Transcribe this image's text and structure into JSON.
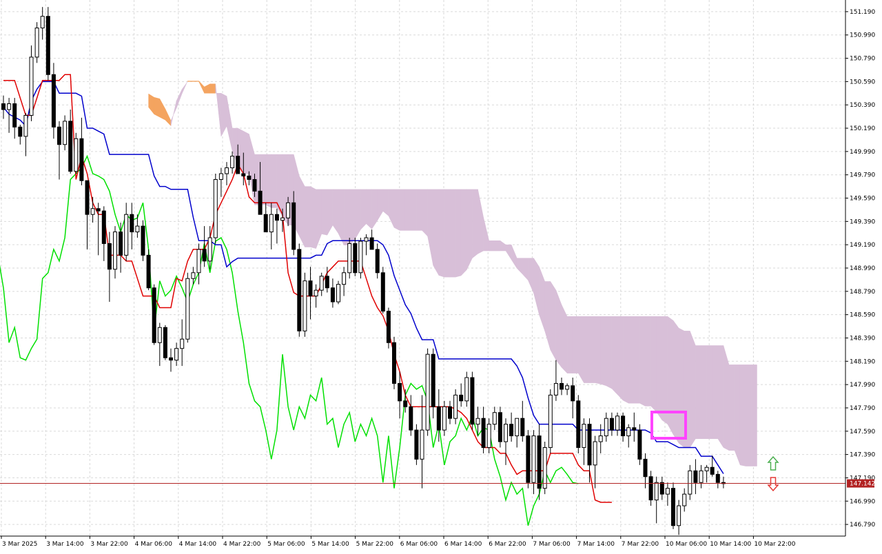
{
  "chart_data": {
    "type": "candlestick",
    "indicator": "Ichimoku Kinko Hyo",
    "ylim": [
      146.69,
      151.29
    ],
    "y_ticks": [
      "151.190",
      "150.990",
      "150.790",
      "150.590",
      "150.390",
      "150.190",
      "149.990",
      "149.790",
      "149.590",
      "149.390",
      "149.190",
      "148.990",
      "148.790",
      "148.590",
      "148.390",
      "148.190",
      "147.990",
      "147.790",
      "147.590",
      "147.390",
      "147.190",
      "146.990",
      "146.790"
    ],
    "x_ticks": [
      "3 Mar 2025",
      "3 Mar 14:00",
      "3 Mar 22:00",
      "4 Mar 06:00",
      "4 Mar 14:00",
      "4 Mar 22:00",
      "5 Mar 06:00",
      "5 Mar 14:00",
      "5 Mar 22:00",
      "6 Mar 06:00",
      "6 Mar 14:00",
      "6 Mar 22:00",
      "7 Mar 06:00",
      "7 Mar 14:00",
      "7 Mar 22:00",
      "10 Mar 06:00",
      "10 Mar 14:00",
      "10 Mar 22:00"
    ],
    "current_price": "147.142",
    "grid": true,
    "colors": {
      "background": "#ffffff",
      "grid": "#d9d9d9",
      "tenkan_sen": "#e00000",
      "kijun_sen": "#0000cc",
      "chikou_span": "#00e000",
      "cloud_bullish": "#f4a460",
      "cloud_bearish": "#d8bfd8",
      "candle_bull_body": "#ffffff",
      "candle_bear_body": "#000000",
      "price_line": "#b22222",
      "highlight_box": "#ff44ff",
      "arrow_up": "#4caf50",
      "arrow_down": "#e53935"
    },
    "candles": [
      [
        150.4,
        150.47,
        150.27,
        150.35
      ],
      [
        150.35,
        150.45,
        150.15,
        150.4
      ],
      [
        150.4,
        150.45,
        150.1,
        150.2
      ],
      [
        150.2,
        150.22,
        150.05,
        150.12
      ],
      [
        150.12,
        150.32,
        149.95,
        150.3
      ],
      [
        150.3,
        150.9,
        150.25,
        150.8
      ],
      [
        150.8,
        151.1,
        150.75,
        151.05
      ],
      [
        151.05,
        151.23,
        150.95,
        151.15
      ],
      [
        151.15,
        151.23,
        150.6,
        150.65
      ],
      [
        150.65,
        150.75,
        150.1,
        150.2
      ],
      [
        150.2,
        150.25,
        149.75,
        150.05
      ],
      [
        150.05,
        150.3,
        150.0,
        150.25
      ],
      [
        150.25,
        150.35,
        149.8,
        149.82
      ],
      [
        149.82,
        150.15,
        149.8,
        150.1
      ],
      [
        150.1,
        150.28,
        149.7,
        149.74
      ],
      [
        149.74,
        149.74,
        149.15,
        149.45
      ],
      [
        149.45,
        149.6,
        149.38,
        149.5
      ],
      [
        149.5,
        149.55,
        149.1,
        149.48
      ],
      [
        149.48,
        149.52,
        149.05,
        149.2
      ],
      [
        149.2,
        149.3,
        148.7,
        148.98
      ],
      [
        148.98,
        149.35,
        148.9,
        149.3
      ],
      [
        149.3,
        149.38,
        148.95,
        149.1
      ],
      [
        149.1,
        149.55,
        149.05,
        149.45
      ],
      [
        149.45,
        149.55,
        149.15,
        149.3
      ],
      [
        149.3,
        149.45,
        149.25,
        149.35
      ],
      [
        149.35,
        149.4,
        149.05,
        149.1
      ],
      [
        149.1,
        149.15,
        148.8,
        148.82
      ],
      [
        148.82,
        148.85,
        148.33,
        148.35
      ],
      [
        148.35,
        148.52,
        148.15,
        148.48
      ],
      [
        148.48,
        148.5,
        148.2,
        148.22
      ],
      [
        148.22,
        148.3,
        148.1,
        148.2
      ],
      [
        148.2,
        148.35,
        148.15,
        148.3
      ],
      [
        148.3,
        148.55,
        148.15,
        148.38
      ],
      [
        148.38,
        148.95,
        148.35,
        148.9
      ],
      [
        148.9,
        149.0,
        148.85,
        148.95
      ],
      [
        148.95,
        149.2,
        148.85,
        149.15
      ],
      [
        149.15,
        149.35,
        149.0,
        149.05
      ],
      [
        149.05,
        149.35,
        148.98,
        149.25
      ],
      [
        149.25,
        149.8,
        149.2,
        149.75
      ],
      [
        149.75,
        149.85,
        149.6,
        149.8
      ],
      [
        149.8,
        149.9,
        149.7,
        149.85
      ],
      [
        149.85,
        149.99,
        149.8,
        149.95
      ],
      [
        149.95,
        150.05,
        149.9,
        149.8
      ],
      [
        149.8,
        149.98,
        149.7,
        149.78
      ],
      [
        149.78,
        149.82,
        149.7,
        149.75
      ],
      [
        149.75,
        149.8,
        149.6,
        149.65
      ],
      [
        149.65,
        149.9,
        149.55,
        149.45
      ],
      [
        149.45,
        149.55,
        149.3,
        149.3
      ],
      [
        149.3,
        149.55,
        149.15,
        149.45
      ],
      [
        149.45,
        149.5,
        149.2,
        149.4
      ],
      [
        149.4,
        149.5,
        149.3,
        149.42
      ],
      [
        149.42,
        149.6,
        149.35,
        149.55
      ],
      [
        149.55,
        149.65,
        149.1,
        149.15
      ],
      [
        149.15,
        149.2,
        148.4,
        148.45
      ],
      [
        148.45,
        148.95,
        148.4,
        148.88
      ],
      [
        148.88,
        149.0,
        148.55,
        148.75
      ],
      [
        148.75,
        148.85,
        148.65,
        148.8
      ],
      [
        148.8,
        148.95,
        148.75,
        148.92
      ],
      [
        148.92,
        149.0,
        148.78,
        148.82
      ],
      [
        148.82,
        148.9,
        148.65,
        148.7
      ],
      [
        148.7,
        148.88,
        148.68,
        148.85
      ],
      [
        148.85,
        149.0,
        148.75,
        148.95
      ],
      [
        148.95,
        149.25,
        148.9,
        149.2
      ],
      [
        149.2,
        149.25,
        148.92,
        148.95
      ],
      [
        148.95,
        149.25,
        148.9,
        149.22
      ],
      [
        149.22,
        149.28,
        149.1,
        149.25
      ],
      [
        149.25,
        149.32,
        149.15,
        149.15
      ],
      [
        149.15,
        149.2,
        148.9,
        148.95
      ],
      [
        148.95,
        149.0,
        148.6,
        148.62
      ],
      [
        148.62,
        148.65,
        148.3,
        148.35
      ],
      [
        148.35,
        148.4,
        147.95,
        148.0
      ],
      [
        148.0,
        148.1,
        147.7,
        147.85
      ],
      [
        147.85,
        147.95,
        147.75,
        147.8
      ],
      [
        147.8,
        147.9,
        147.55,
        147.6
      ],
      [
        147.6,
        147.65,
        147.3,
        147.35
      ],
      [
        147.35,
        147.9,
        147.1,
        147.6
      ],
      [
        147.6,
        148.3,
        147.55,
        148.25
      ],
      [
        148.25,
        148.3,
        147.7,
        147.8
      ],
      [
        147.8,
        147.95,
        147.5,
        147.6
      ],
      [
        147.6,
        147.85,
        147.55,
        147.8
      ],
      [
        147.8,
        147.85,
        147.65,
        147.7
      ],
      [
        147.7,
        147.95,
        147.65,
        147.9
      ],
      [
        147.9,
        148.0,
        147.8,
        147.85
      ],
      [
        147.85,
        148.1,
        147.8,
        148.05
      ],
      [
        148.05,
        148.1,
        147.6,
        147.65
      ],
      [
        147.65,
        147.8,
        147.55,
        147.7
      ],
      [
        147.7,
        147.8,
        147.4,
        147.45
      ],
      [
        147.45,
        147.7,
        147.4,
        147.65
      ],
      [
        147.65,
        147.8,
        147.6,
        147.75
      ],
      [
        147.75,
        147.8,
        147.45,
        147.5
      ],
      [
        147.5,
        147.7,
        147.3,
        147.65
      ],
      [
        147.65,
        147.75,
        147.5,
        147.55
      ],
      [
        147.55,
        147.7,
        147.45,
        147.7
      ],
      [
        147.7,
        147.85,
        147.5,
        147.55
      ],
      [
        147.55,
        147.6,
        147.1,
        147.15
      ],
      [
        147.15,
        147.6,
        147.05,
        147.55
      ],
      [
        147.55,
        147.65,
        147.0,
        147.1
      ],
      [
        147.1,
        147.5,
        147.05,
        147.45
      ],
      [
        147.45,
        147.95,
        147.4,
        147.9
      ],
      [
        147.9,
        148.2,
        147.85,
        148.0
      ],
      [
        148.0,
        148.05,
        147.9,
        147.95
      ],
      [
        147.95,
        148.0,
        147.9,
        147.98
      ],
      [
        147.98,
        148.05,
        147.7,
        147.85
      ],
      [
        147.85,
        147.9,
        147.4,
        147.45
      ],
      [
        147.45,
        147.7,
        147.3,
        147.65
      ],
      [
        147.65,
        147.7,
        147.15,
        147.3
      ],
      [
        147.3,
        147.55,
        147.1,
        147.5
      ],
      [
        147.5,
        147.65,
        147.4,
        147.55
      ],
      [
        147.55,
        147.75,
        147.5,
        147.7
      ],
      [
        147.7,
        147.75,
        147.55,
        147.6
      ],
      [
        147.6,
        147.75,
        147.55,
        147.72
      ],
      [
        147.72,
        147.75,
        147.5,
        147.55
      ],
      [
        147.55,
        147.65,
        147.45,
        147.62
      ],
      [
        147.62,
        147.75,
        147.5,
        147.6
      ],
      [
        147.6,
        147.65,
        147.3,
        147.35
      ],
      [
        147.35,
        147.4,
        147.1,
        147.2
      ],
      [
        147.2,
        147.25,
        146.95,
        147.0
      ],
      [
        147.0,
        147.2,
        146.8,
        147.15
      ],
      [
        147.15,
        147.2,
        147.0,
        147.05
      ],
      [
        147.05,
        147.15,
        146.95,
        147.1
      ],
      [
        147.1,
        147.15,
        146.75,
        146.78
      ],
      [
        146.78,
        147.0,
        146.7,
        146.95
      ],
      [
        146.95,
        147.1,
        146.9,
        147.05
      ],
      [
        147.05,
        147.3,
        147.0,
        147.25
      ],
      [
        147.25,
        147.35,
        147.05,
        147.15
      ],
      [
        147.15,
        147.3,
        147.1,
        147.25
      ],
      [
        147.25,
        147.3,
        147.15,
        147.28
      ],
      [
        147.28,
        147.38,
        147.2,
        147.22
      ],
      [
        147.22,
        147.25,
        147.1,
        147.15
      ],
      [
        147.15,
        147.2,
        147.1,
        147.14
      ]
    ],
    "tenkan_sen": [
      150.6,
      150.6,
      150.6,
      150.45,
      150.3,
      150.3,
      150.45,
      150.6,
      150.6,
      150.6,
      150.6,
      150.65,
      150.65,
      149.75,
      149.95,
      149.8,
      149.55,
      149.45,
      149.45,
      149.1,
      149.1,
      149.1,
      149.05,
      149.05,
      148.9,
      148.75,
      148.75,
      148.75,
      148.65,
      148.65,
      148.65,
      148.9,
      148.88,
      149.05,
      149.15,
      149.15,
      149.15,
      149.25,
      149.45,
      149.55,
      149.65,
      149.75,
      149.88,
      149.8,
      149.6,
      149.55,
      149.55,
      149.55,
      149.55,
      149.55,
      149.45,
      148.95,
      148.78,
      148.75,
      148.75,
      148.75,
      148.75,
      148.85,
      148.95,
      149.0,
      149.05,
      149.05,
      149.05,
      149.05,
      149.05,
      148.9,
      148.75,
      148.65,
      148.58,
      148.45,
      148.25,
      148.1,
      147.9,
      147.8,
      147.8,
      147.8,
      147.8,
      147.8,
      147.8,
      147.8,
      147.8,
      147.78,
      147.75,
      147.7,
      147.6,
      147.5,
      147.45,
      147.45,
      147.45,
      147.4,
      147.4,
      147.3,
      147.22,
      147.25,
      147.25,
      147.25,
      147.25,
      147.25,
      147.4,
      147.4,
      147.4,
      147.4,
      147.4,
      147.3,
      147.25,
      147.25,
      147.0,
      146.98,
      146.98,
      146.98
    ]
  }
}
